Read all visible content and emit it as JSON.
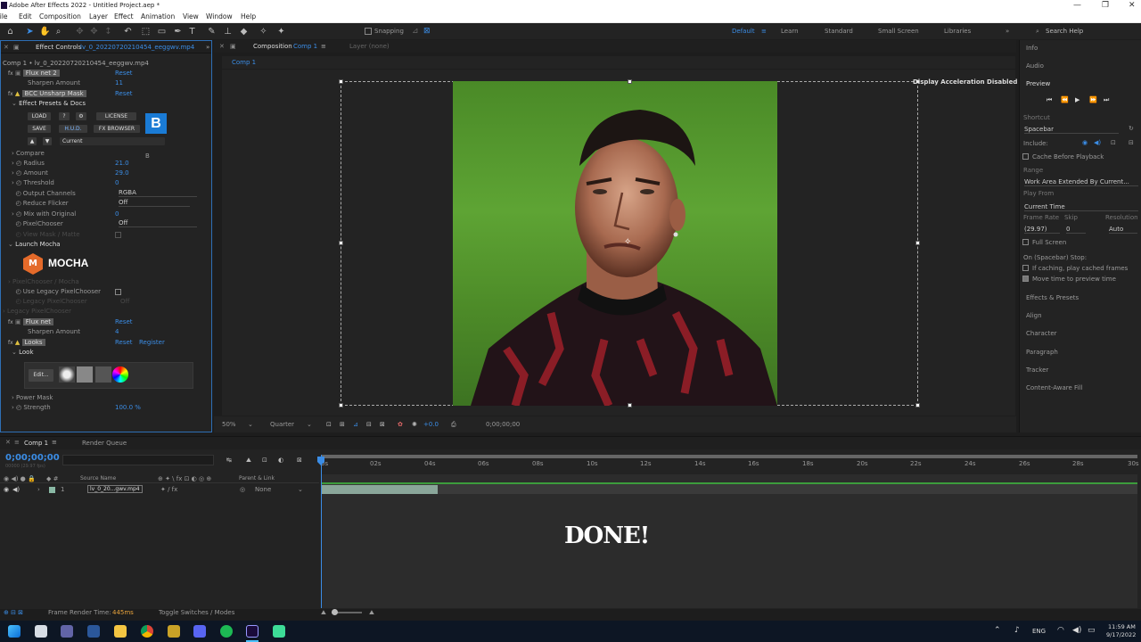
{
  "window": {
    "title": "Adobe After Effects 2022 - Untitled Project.aep *",
    "controls": [
      "—",
      "❐",
      "✕"
    ]
  },
  "menu": [
    "File",
    "Edit",
    "Composition",
    "Layer",
    "Effect",
    "Animation",
    "View",
    "Window",
    "Help"
  ],
  "toolbar": {
    "snapping": "Snapping",
    "workspaces": [
      "Default",
      "Learn",
      "Standard",
      "Small Screen",
      "Libraries"
    ],
    "search": "Search Help"
  },
  "effect_controls": {
    "tab": "Effect Controls",
    "file": "lv_0_20220720210454_eeggwv.mp4",
    "breadcrumb": "Comp 1 • lv_0_20220720210454_eeggwv.mp4",
    "items": [
      {
        "name": "Flux net 2",
        "value": "Reset"
      },
      {
        "name": "Sharpen Amount",
        "value": "11"
      },
      {
        "name": "BCC Unsharp Mask",
        "value": "Reset"
      },
      {
        "name": "Effect Presets & Docs",
        "value": ""
      }
    ],
    "bcc_buttons": {
      "load": "LOAD",
      "help": "?",
      "gear": "⚙",
      "license": "LICENSE",
      "save": "SAVE",
      "hud": "H.U.D.",
      "fx_browser": "FX BROWSER",
      "current": "Current",
      "logo": "B"
    },
    "params": [
      {
        "name": "Compare",
        "value": ""
      },
      {
        "name": "Radius",
        "value": "21.0"
      },
      {
        "name": "Amount",
        "value": "29.0"
      },
      {
        "name": "Threshold",
        "value": "0"
      },
      {
        "name": "Output Channels",
        "value": "RGBA"
      },
      {
        "name": "Reduce Flicker",
        "value": "Off"
      },
      {
        "name": "Mix with Original",
        "value": "0"
      },
      {
        "name": "PixelChooser",
        "value": "Off"
      },
      {
        "name": "View Mask / Matte",
        "value": ""
      },
      {
        "name": "Launch Mocha",
        "value": ""
      }
    ],
    "mocha": "MOCHA",
    "after_mocha": [
      {
        "name": "PixelChooser / Mocha",
        "value": ""
      },
      {
        "name": "Use Legacy PixelChooser",
        "value": ""
      },
      {
        "name": "Legacy PixelChooser",
        "value": "Off"
      },
      {
        "name": "Legacy PixelChooser",
        "value": ""
      },
      {
        "name": "Flux net",
        "value": "Reset"
      },
      {
        "name": "Sharpen Amount",
        "value": "4"
      },
      {
        "name": "Looks",
        "value": "Reset",
        "extra": "Register"
      },
      {
        "name": "Look",
        "value": ""
      }
    ],
    "edit_btn": "Edit...",
    "power_mask": "Power Mask",
    "strength": {
      "name": "Strength",
      "value": "100.0 %"
    }
  },
  "composition": {
    "tab": "Composition",
    "name": "Comp 1",
    "layer_tab": "Layer (none)",
    "breadcrumb": "Comp 1",
    "notice": "Display Acceleration Disabled",
    "zoom": "50%",
    "resolution": "Quarter",
    "exposure": "+0.0",
    "timecode": "0;00;00;00"
  },
  "right_panel": {
    "sections_top": [
      "Info",
      "Audio"
    ],
    "preview": {
      "title": "Preview",
      "shortcut_label": "Shortcut",
      "shortcut": "Spacebar",
      "include": "Include:",
      "cache": "Cache Before Playback",
      "range_label": "Range",
      "range": "Work Area Extended By Current...",
      "play_from_label": "Play From",
      "play_from": "Current Time",
      "frame_rate_label": "Frame Rate",
      "skip_label": "Skip",
      "resolution_label": "Resolution",
      "frame_rate": "(29.97)",
      "skip": "0",
      "resolution": "Auto",
      "full_screen": "Full Screen",
      "stop": "On (Spacebar) Stop:",
      "if_caching": "If caching, play cached frames",
      "move_time": "Move time to preview time"
    },
    "sections_bottom": [
      "Effects & Presets",
      "Align",
      "Character",
      "Paragraph",
      "Tracker",
      "Content-Aware Fill"
    ]
  },
  "timeline": {
    "tab": "Comp 1",
    "render_queue": "Render Queue",
    "timecode": "0;00;00;00",
    "fps": "00000 (29.97 fps)",
    "col_source": "Source Name",
    "col_parent": "Parent & Link",
    "layer": {
      "num": "1",
      "name": "lv_0_20...gwv.mp4",
      "parent": "None"
    },
    "ticks": [
      "0s",
      "02s",
      "04s",
      "06s",
      "08s",
      "10s",
      "12s",
      "14s",
      "16s",
      "18s",
      "20s",
      "22s",
      "24s",
      "26s",
      "28s",
      "30s"
    ],
    "frame_render_label": "Frame Render Time:",
    "frame_render_value": "445ms",
    "toggle": "Toggle Switches / Modes",
    "overlay": "DONE!"
  },
  "taskbar": {
    "lang": "ENG",
    "time": "11:59 AM",
    "date": "9/17/2022"
  }
}
